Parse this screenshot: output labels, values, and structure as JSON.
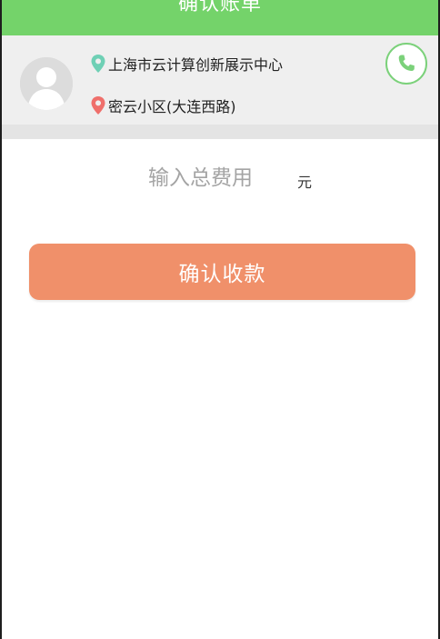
{
  "header": {
    "title": "确认账单"
  },
  "trip": {
    "origin": "上海市云计算创新展示中心",
    "destination": "密云小区(大连西路)"
  },
  "icons": {
    "avatar": "user-avatar-icon",
    "origin_pin": "location-pin-icon",
    "destination_pin": "location-pin-icon",
    "call": "phone-icon"
  },
  "fee": {
    "placeholder": "输入总费用",
    "value": "",
    "unit": "元"
  },
  "actions": {
    "confirm_label": "确认收款"
  },
  "colors": {
    "header": "#74d36a",
    "origin_pin": "#6fd0b5",
    "destination_pin": "#ef6f6b",
    "call_icon": "#7bd17a",
    "confirm_button": "#f0906a"
  }
}
